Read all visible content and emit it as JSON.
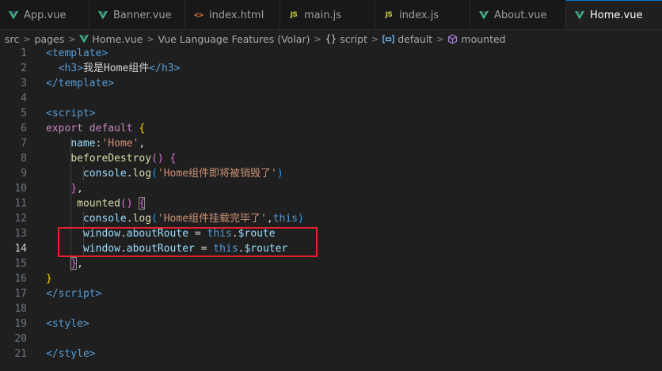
{
  "colors": {
    "vue_icon": "#41b883",
    "js_icon": "#cbcb41",
    "html_icon": "#e37933",
    "tag": "#569cd6",
    "keyword": "#c586c0",
    "func": "#dcdcaa",
    "prop": "#9cdcfe",
    "string": "#ce9178",
    "brace1": "#ffd700",
    "brace2": "#da70d6",
    "brace3": "#179fff",
    "this": "#569cd6",
    "text": "#d4d4d4",
    "plain": "#cccccc",
    "highlight": "#e8212e"
  },
  "tabs": [
    {
      "label": "App.vue",
      "icon": "vue-icon"
    },
    {
      "label": "Banner.vue",
      "icon": "vue-icon"
    },
    {
      "label": "index.html",
      "icon": "html-icon"
    },
    {
      "label": "main.js",
      "icon": "js-icon"
    },
    {
      "label": "index.js",
      "icon": "js-icon"
    },
    {
      "label": "About.vue",
      "icon": "vue-icon"
    },
    {
      "label": "Home.vue",
      "icon": "vue-icon",
      "active": true
    }
  ],
  "breadcrumb": {
    "src": "src",
    "pages": "pages",
    "file": "Home.vue",
    "lang": "Vue Language Features (Volar)",
    "script": "script",
    "default": "default",
    "mounted": "mounted"
  },
  "code_lines": [
    [
      [
        "<",
        "tag"
      ],
      [
        "template",
        "tag"
      ],
      [
        ">",
        "tag"
      ]
    ],
    [
      [
        "  ",
        "text"
      ],
      [
        "<",
        "tag"
      ],
      [
        "h3",
        "tag"
      ],
      [
        ">",
        "tag"
      ],
      [
        "我是Home组件",
        "text"
      ],
      [
        "</",
        "tag"
      ],
      [
        "h3",
        "tag"
      ],
      [
        ">",
        "tag"
      ]
    ],
    [
      [
        "</",
        "tag"
      ],
      [
        "template",
        "tag"
      ],
      [
        ">",
        "tag"
      ]
    ],
    [],
    [
      [
        "<",
        "tag"
      ],
      [
        "script",
        "tag"
      ],
      [
        ">",
        "tag"
      ]
    ],
    [
      [
        "export",
        "keyword"
      ],
      [
        " ",
        "text"
      ],
      [
        "default",
        "keyword"
      ],
      [
        " ",
        "text"
      ],
      [
        "{",
        "brace1"
      ]
    ],
    [
      [
        "    ",
        "text"
      ],
      [
        "name",
        "prop"
      ],
      [
        ":",
        "text"
      ],
      [
        "'Home'",
        "string"
      ],
      [
        ",",
        "text"
      ]
    ],
    [
      [
        "    ",
        "text"
      ],
      [
        "beforeDestroy",
        "func"
      ],
      [
        "()",
        "brace2"
      ],
      [
        " ",
        "text"
      ],
      [
        "{",
        "brace2"
      ]
    ],
    [
      [
        "      ",
        "text"
      ],
      [
        "console",
        "prop"
      ],
      [
        ".",
        "text"
      ],
      [
        "log",
        "func"
      ],
      [
        "(",
        "brace3"
      ],
      [
        "'Home组件即将被销毁了'",
        "string"
      ],
      [
        ")",
        "brace3"
      ]
    ],
    [
      [
        "    ",
        "text"
      ],
      [
        "}",
        "brace2"
      ],
      [
        ",",
        "text"
      ]
    ],
    [
      [
        "     ",
        "text"
      ],
      [
        "mounted",
        "func"
      ],
      [
        "()",
        "brace2"
      ],
      [
        " ",
        "text"
      ],
      [
        "{",
        "brace2"
      ]
    ],
    [
      [
        "      ",
        "text"
      ],
      [
        "console",
        "prop"
      ],
      [
        ".",
        "text"
      ],
      [
        "log",
        "func"
      ],
      [
        "(",
        "brace3"
      ],
      [
        "'Home组件挂载完毕了'",
        "string"
      ],
      [
        ",",
        "text"
      ],
      [
        "this",
        "this"
      ],
      [
        ")",
        "brace3"
      ]
    ],
    [
      [
        "      ",
        "text"
      ],
      [
        "window",
        "prop"
      ],
      [
        ".",
        "text"
      ],
      [
        "aboutRoute",
        "prop"
      ],
      [
        " = ",
        "text"
      ],
      [
        "this",
        "this"
      ],
      [
        ".",
        "text"
      ],
      [
        "$route",
        "prop"
      ]
    ],
    [
      [
        "      ",
        "text"
      ],
      [
        "window",
        "prop"
      ],
      [
        ".",
        "text"
      ],
      [
        "aboutRouter",
        "prop"
      ],
      [
        " = ",
        "text"
      ],
      [
        "this",
        "this"
      ],
      [
        ".",
        "text"
      ],
      [
        "$router",
        "prop"
      ]
    ],
    [
      [
        "    ",
        "text"
      ],
      [
        "}",
        "brace2"
      ],
      [
        ",",
        "text"
      ]
    ],
    [
      [
        "}",
        "brace1"
      ]
    ],
    [
      [
        "</",
        "tag"
      ],
      [
        "script",
        "tag"
      ],
      [
        ">",
        "tag"
      ]
    ],
    [],
    [
      [
        "<",
        "tag"
      ],
      [
        "style",
        "tag"
      ],
      [
        ">",
        "tag"
      ]
    ],
    [],
    [
      [
        "</",
        "tag"
      ],
      [
        "style",
        "tag"
      ],
      [
        ">",
        "tag"
      ]
    ]
  ],
  "current_line": 14
}
